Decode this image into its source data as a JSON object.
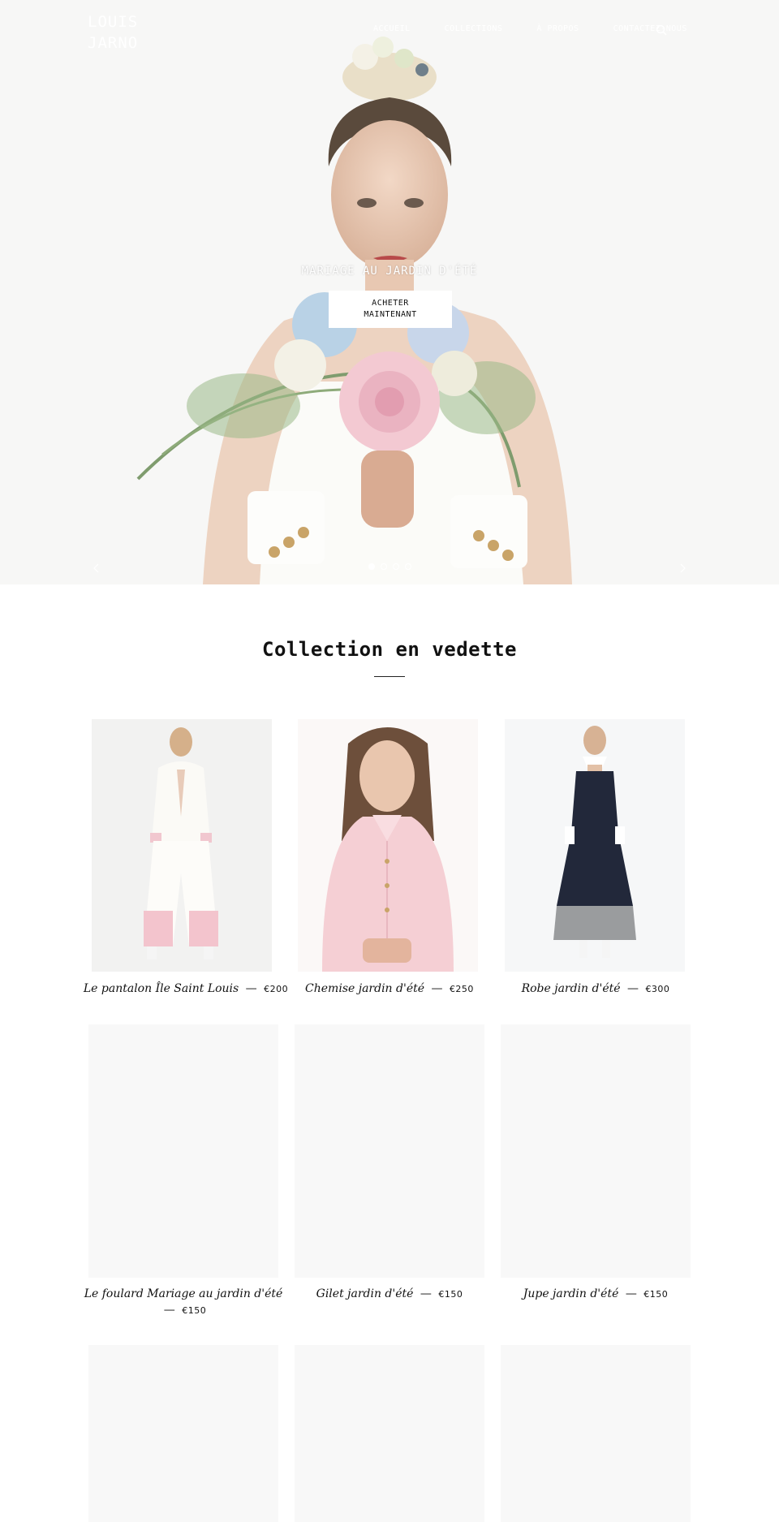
{
  "header": {
    "logo": "LOUIS JARNO",
    "nav": [
      "ACCUEIL",
      "COLLECTIONS",
      "À PROPOS",
      "CONTACTEZ-NOUS"
    ]
  },
  "hero": {
    "caption": "MARIAGE AU JARDIN D'ÉTÉ",
    "cta_label": "ACHETER MAINTENANT",
    "slides_total": 4,
    "slide_active": 1
  },
  "collection": {
    "title": "Collection en vedette",
    "products": [
      {
        "name": "Le pantalon Île Saint Louis",
        "dash": "—",
        "price": "€200"
      },
      {
        "name": "Chemise jardin d'été",
        "dash": "—",
        "price": "€250"
      },
      {
        "name": "Robe jardin d'été",
        "dash": "—",
        "price": "€300"
      },
      {
        "name": "Le foulard Mariage au jardin d'été",
        "dash": "—",
        "price": "€150"
      },
      {
        "name": "Gilet jardin d'été",
        "dash": "—",
        "price": "€150"
      },
      {
        "name": "Jupe jardin d'été",
        "dash": "—",
        "price": "€150"
      }
    ]
  },
  "colors": {
    "background": "#ffffff",
    "placeholder": "#f8f8f8",
    "text": "#111111"
  }
}
